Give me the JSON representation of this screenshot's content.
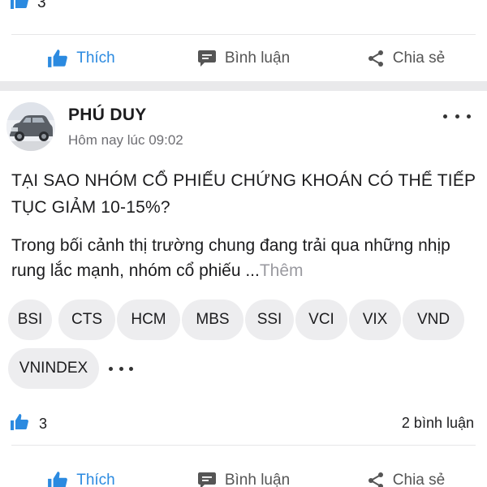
{
  "previous_post": {
    "like_count": "3",
    "actions": {
      "like": "Thích",
      "comment": "Bình luận",
      "share": "Chia sẻ"
    }
  },
  "post": {
    "author": "PHÚ DUY",
    "time": "Hôm nay lúc 09:02",
    "title": "TẠI SAO NHÓM CỔ PHIẾU CHỨNG KHOÁN CÓ THỂ TIẾP TỤC GIẢM 10-15%?",
    "body": "Trong bối cảnh thị trường chung đang trải qua những nhịp rung lắc mạnh, nhóm cổ phiếu ...",
    "more_label": "Thêm",
    "tags": [
      "BSI",
      "CTS",
      "HCM",
      "MBS",
      "SSI",
      "VCI",
      "VIX",
      "VND",
      "VNINDEX"
    ],
    "like_count": "3",
    "comment_count": "2 bình luận",
    "actions": {
      "like": "Thích",
      "comment": "Bình luận",
      "share": "Chia sẻ"
    }
  },
  "colors": {
    "like_blue": "#2b8ae0",
    "tag_bg": "#ededef",
    "muted": "#6e6e73"
  },
  "icons": [
    "thumbs-up-icon",
    "comment-bubble-icon",
    "share-icon",
    "more-dots-icon"
  ]
}
